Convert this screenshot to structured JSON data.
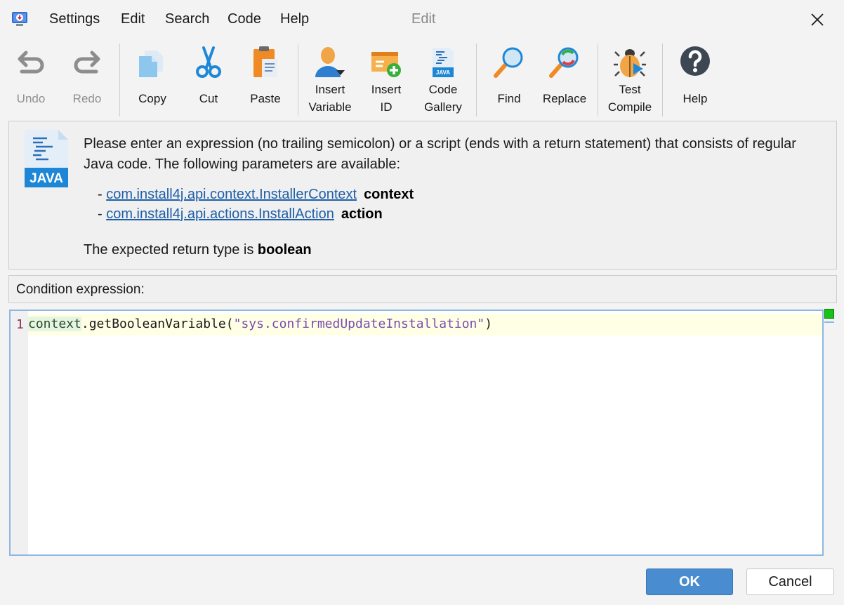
{
  "menu": {
    "settings": "Settings",
    "edit": "Edit",
    "search": "Search",
    "code": "Code",
    "help": "Help"
  },
  "window": {
    "title": "Edit"
  },
  "toolbar": {
    "undo": "Undo",
    "redo": "Redo",
    "copy": "Copy",
    "cut": "Cut",
    "paste": "Paste",
    "insert_variable_1": "Insert",
    "insert_variable_2": "Variable",
    "insert_id_1": "Insert",
    "insert_id_2": "ID",
    "code_gallery_1": "Code",
    "code_gallery_2": "Gallery",
    "find": "Find",
    "replace": "Replace",
    "test_compile_1": "Test",
    "test_compile_2": "Compile",
    "help": "Help"
  },
  "info": {
    "java_badge": "JAVA",
    "description": "Please enter an expression (no trailing semicolon) or a script (ends with a return statement) that consists of regular Java code. The following parameters are available:",
    "params": [
      {
        "type": "com.install4j.api.context.InstallerContext",
        "name": "context"
      },
      {
        "type": "com.install4j.api.actions.InstallAction",
        "name": "action"
      }
    ],
    "return_prefix": "The expected return type is",
    "return_type": "boolean"
  },
  "condition": {
    "label": "Condition expression:"
  },
  "editor": {
    "line_number": "1",
    "code_var": "context",
    "code_method": ".getBooleanVariable(",
    "code_string": "\"sys.confirmedUpdateInstallation\"",
    "code_end": ")"
  },
  "buttons": {
    "ok": "OK",
    "cancel": "Cancel"
  },
  "colors": {
    "accent": "#4a8cd0",
    "link": "#1e5fa8",
    "status_ok": "#15c415"
  }
}
